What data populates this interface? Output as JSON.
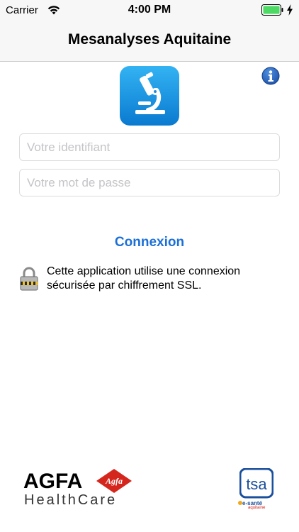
{
  "status_bar": {
    "carrier": "Carrier",
    "time": "4:00 PM",
    "battery_color": "#4cd964"
  },
  "nav": {
    "title": "Mesanalyses Aquitaine"
  },
  "header_icons": {
    "app_icon": "microscope-icon",
    "info": "info-icon"
  },
  "login": {
    "username_placeholder": "Votre identifiant",
    "username_value": "",
    "password_placeholder": "Votre mot de passe",
    "password_value": "",
    "connect_label": "Connexion"
  },
  "security": {
    "icon": "padlock-icon",
    "message": "Cette application utilise une connexion sécurisée par chiffrement SSL."
  },
  "footer": {
    "agfa_name": "AGFA",
    "agfa_badge": "Agfa",
    "agfa_tagline": "HealthCare",
    "tsa_mark": "tsa",
    "tsa_name": "e-santé",
    "tsa_region": "aquitaine"
  },
  "colors": {
    "accent": "#1b6fd6",
    "bar_background": "#f7f7f7",
    "agfa_red": "#d5261d",
    "tsa_blue": "#1a4f9c"
  }
}
